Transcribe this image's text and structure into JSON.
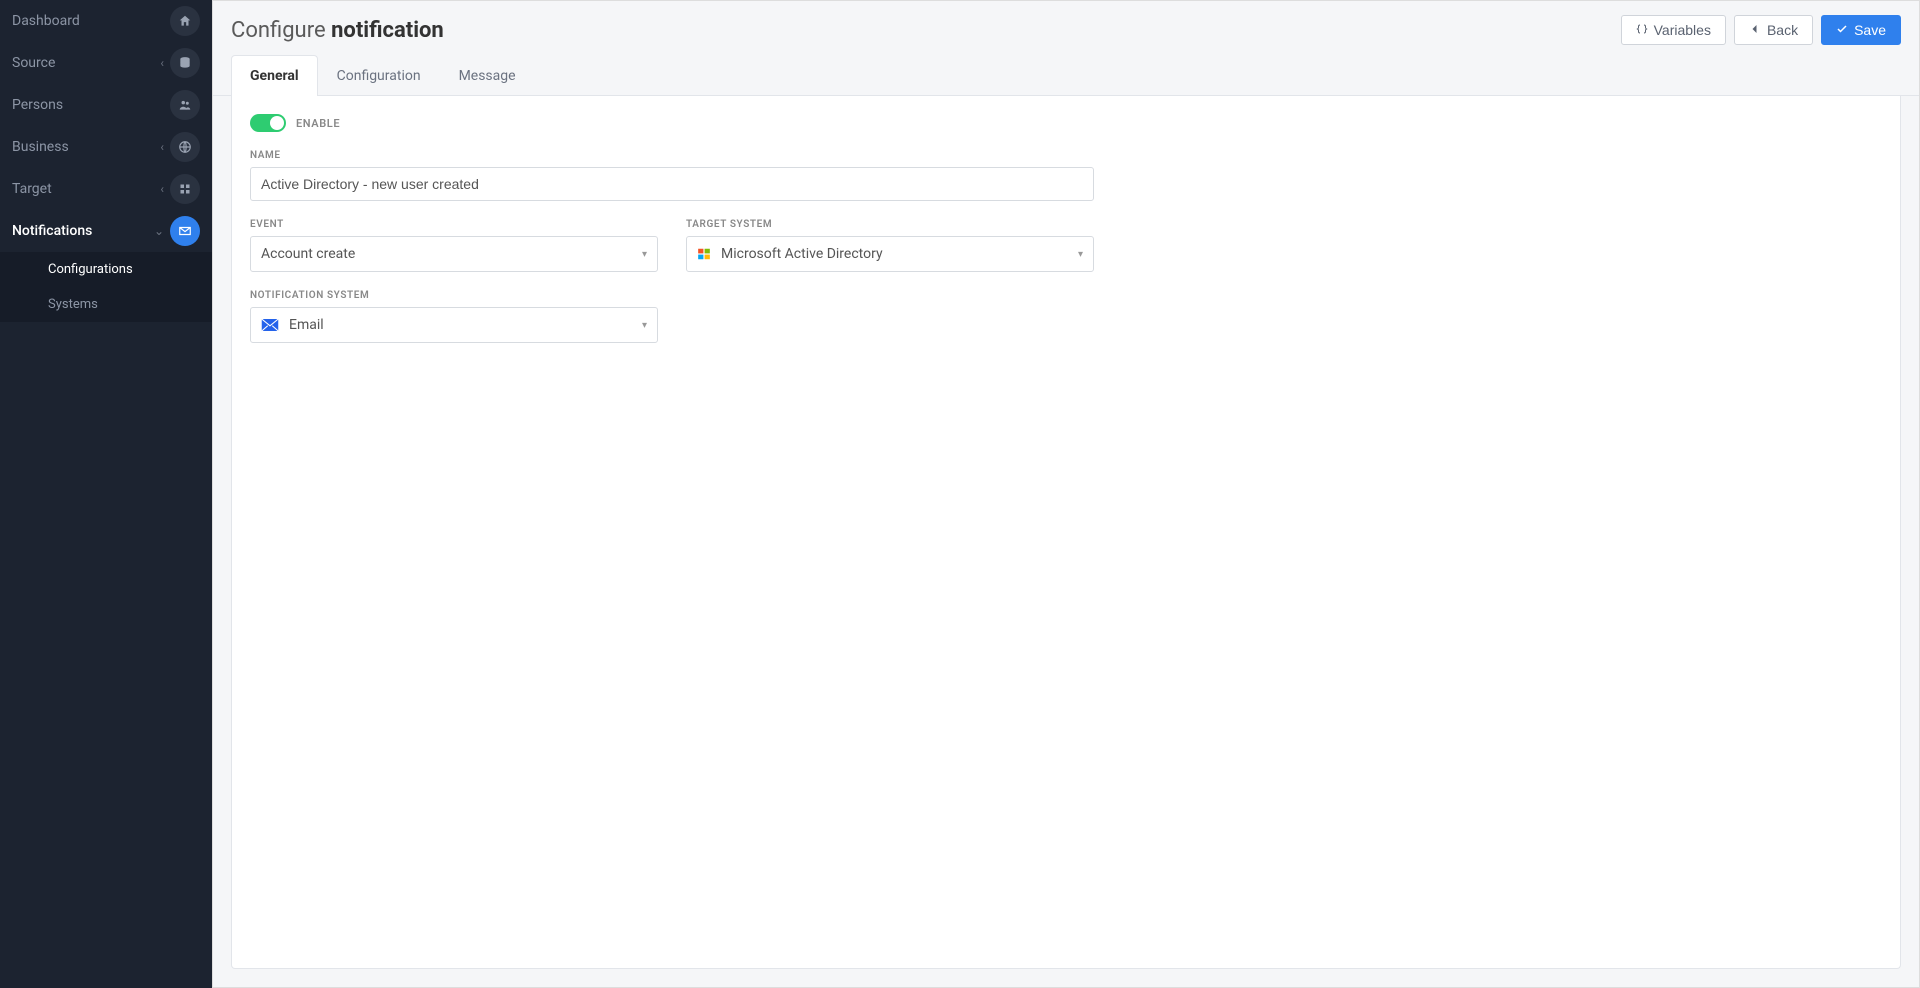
{
  "sidebar": {
    "items": [
      {
        "label": "Dashboard",
        "icon": "home-icon",
        "expandable": false
      },
      {
        "label": "Source",
        "icon": "database-icon",
        "expandable": true
      },
      {
        "label": "Persons",
        "icon": "users-icon",
        "expandable": false
      },
      {
        "label": "Business",
        "icon": "globe-icon",
        "expandable": true
      },
      {
        "label": "Target",
        "icon": "grid-icon",
        "expandable": true
      },
      {
        "label": "Notifications",
        "icon": "mail-icon",
        "expandable": true,
        "active": true
      }
    ],
    "subnav": [
      {
        "label": "Configurations",
        "active": true
      },
      {
        "label": "Systems",
        "active": false
      }
    ]
  },
  "header": {
    "title_prefix": "Configure",
    "title_bold": "notification",
    "variables_btn": "Variables",
    "back_btn": "Back",
    "save_btn": "Save"
  },
  "tabs": [
    {
      "label": "General",
      "active": true
    },
    {
      "label": "Configuration",
      "active": false
    },
    {
      "label": "Message",
      "active": false
    }
  ],
  "form": {
    "enable_label": "ENABLE",
    "name_label": "NAME",
    "name_value": "Active Directory - new user created",
    "event_label": "EVENT",
    "event_value": "Account create",
    "target_label": "TARGET SYSTEM",
    "target_value": "Microsoft Active Directory",
    "notif_sys_label": "NOTIFICATION SYSTEM",
    "notif_sys_value": "Email"
  }
}
